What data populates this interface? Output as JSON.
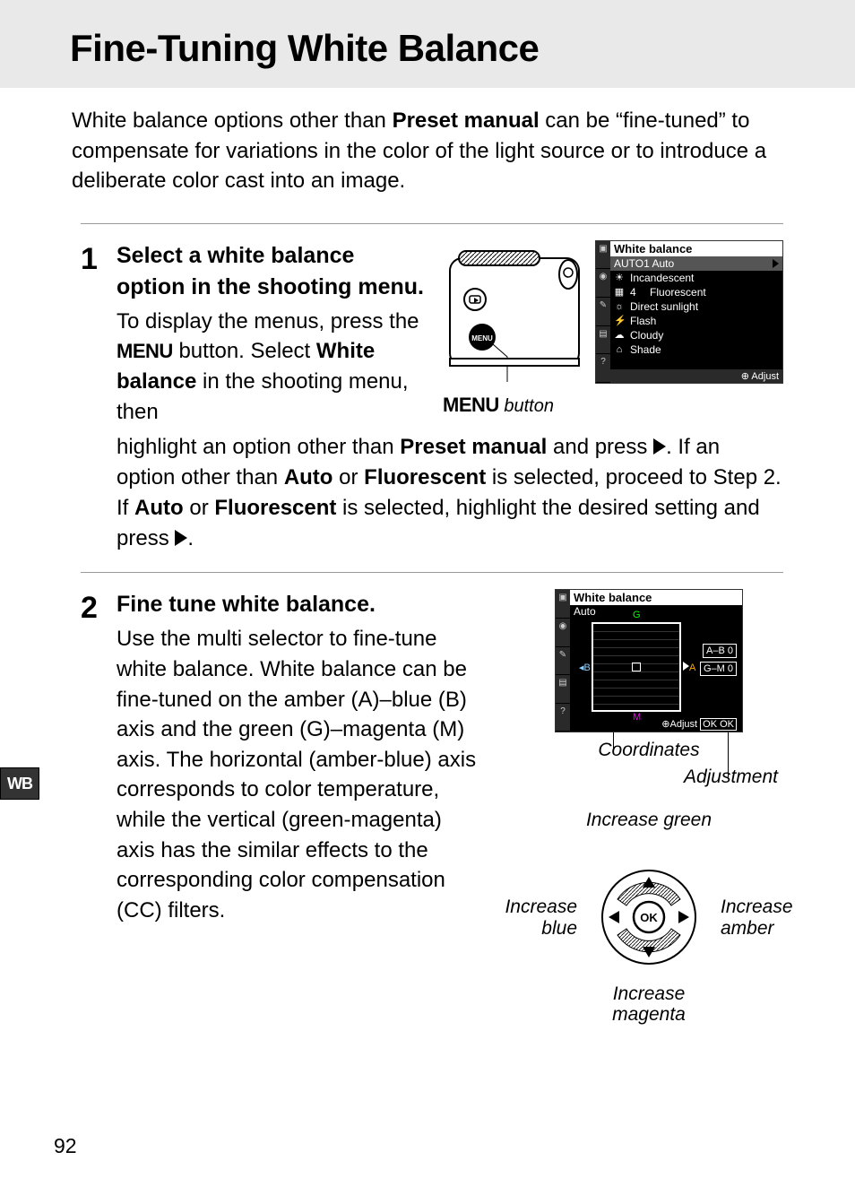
{
  "title": "Fine-Tuning White Balance",
  "intro": {
    "pre": "White balance options other than ",
    "bold": "Preset manual",
    "post": " can be “fine-tuned” to compensate for variations in the color of the light source or to introduce a deliberate color cast into an image."
  },
  "step1": {
    "num": "1",
    "title": "Select a white balance option in the shooting menu.",
    "p1a": "To display the menus, press the ",
    "menu_word": "MENU",
    "p1b": " button. Select ",
    "wb_bold": "White balance",
    "p1c": " in the shooting menu, then",
    "caption_button": " button",
    "cont_a": "highlight an option other than ",
    "preset": "Preset manual",
    "cont_b": " and press ",
    "cont_c": ". If an option other than ",
    "auto": "Auto",
    "or": " or ",
    "fluor": "Fluorescent",
    "cont_d": " is selected, proceed to Step 2. If ",
    "cont_e": " is selected, highlight the desired setting and press "
  },
  "lcd1": {
    "title": "White balance",
    "auto": "AUTO1 Auto",
    "rows": [
      "Incandescent",
      "Fluorescent",
      "Direct sunlight",
      "Flash",
      "Cloudy",
      "Shade"
    ],
    "row_num": "4",
    "foot": "Adjust"
  },
  "step2": {
    "num": "2",
    "title": "Fine tune white balance.",
    "body": "Use the multi selector to fine-tune white balance. White balance can be fine-tuned on the amber (A)–blue (B) axis and the green (G)–magenta (M) axis. The horizontal (amber-blue) axis corresponds to color temperature, while the vertical (green-magenta) axis has the similar effects to the corresponding color compensation (CC) filters."
  },
  "lcd2": {
    "title": "White balance",
    "sub": "Auto",
    "ab": "A–B  0",
    "gm": "G–M  0",
    "g": "G",
    "m": "M",
    "a": "A",
    "b": "B",
    "adjust": "Adjust",
    "ok": "OK OK"
  },
  "annot": {
    "coordinates": "Coordinates",
    "adjustment": "Adjustment",
    "inc_green": "Increase green",
    "inc_blue": "Increase blue",
    "inc_amber": "Increase amber",
    "inc_magenta": "Increase magenta",
    "ok": "OK"
  },
  "side_tab": "WB",
  "page_number": "92"
}
